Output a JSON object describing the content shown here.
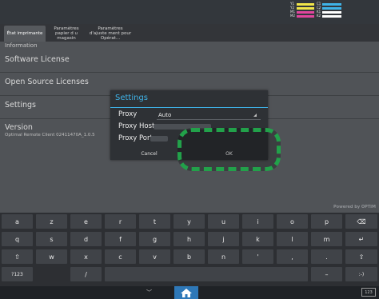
{
  "toner": {
    "labels": [
      "Y1",
      "Y2",
      "M1",
      "M2",
      "C1",
      "C2",
      "K1",
      "K2"
    ],
    "colors": {
      "yellow": "#f2e64a",
      "magenta": "#e2459e",
      "cyan": "#3fb3e8",
      "black": "#ffffff"
    }
  },
  "tabs": [
    {
      "label": "État imprimante"
    },
    {
      "label": "Paramètres papier d u magasin"
    },
    {
      "label": "Paramètres d'ajuste ment pour Opérat..."
    }
  ],
  "info": {
    "header": "Information",
    "software_license": "Software License",
    "open_source": "Open Source Licenses",
    "settings": "Settings",
    "version": "Version",
    "version_value": "Optimal Remote Client 02411470A_1.0.5"
  },
  "dialog": {
    "title": "Settings",
    "proxy_label": "Proxy",
    "proxy_value": "Auto",
    "proxy_host_label": "Proxy Host",
    "proxy_port_label": "Proxy Port",
    "cancel_label": "Cancel",
    "ok_label": "OK"
  },
  "footer": {
    "brand": "Powered by OPTIM"
  },
  "keyboard": {
    "row1": [
      "a",
      "z",
      "e",
      "r",
      "t",
      "y",
      "u",
      "i",
      "o",
      "p",
      "⌫"
    ],
    "row2": [
      "q",
      "s",
      "d",
      "f",
      "g",
      "h",
      "j",
      "k",
      "l",
      "m",
      "↵"
    ],
    "row3": [
      "⇧",
      "w",
      "x",
      "c",
      "v",
      "b",
      "n",
      "'",
      ",",
      ".",
      "⇧"
    ],
    "row4": [
      "?123",
      "/",
      "'",
      "–",
      ":-)"
    ]
  },
  "navbar": {
    "chevron": "﹀",
    "keyboard_mode": "123"
  },
  "colors": {
    "accent": "#3fb3e8",
    "highlight": "#22a14a",
    "home": "#2e78b8"
  }
}
